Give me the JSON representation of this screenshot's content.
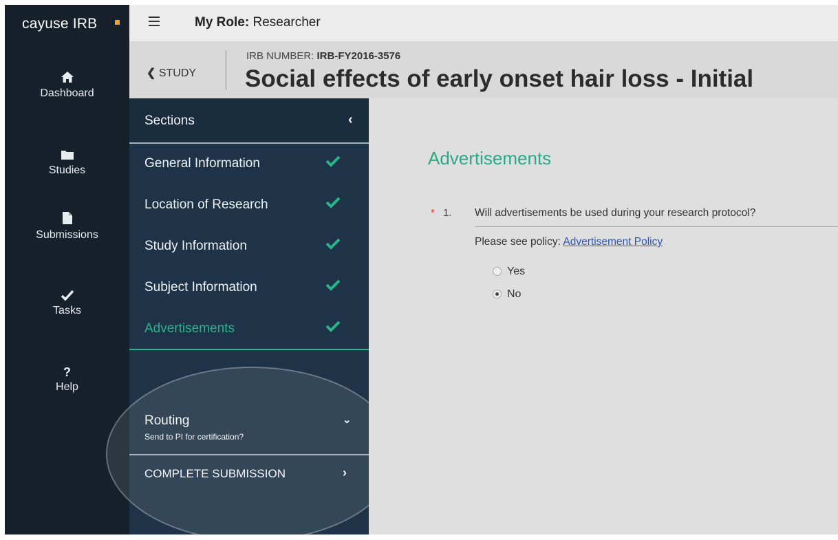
{
  "nav": {
    "brand": "cayuse IRB",
    "items": [
      {
        "label": "Dashboard",
        "icon": "home-icon"
      },
      {
        "label": "Studies",
        "icon": "folder-icon"
      },
      {
        "label": "Submissions",
        "icon": "document-icon"
      },
      {
        "label": "Tasks",
        "icon": "check-icon"
      },
      {
        "label": "Help",
        "icon": "question-icon"
      }
    ]
  },
  "topbar": {
    "role_label": "My Role:",
    "role_value": "Researcher"
  },
  "header": {
    "back_label": "STUDY",
    "irb_label": "IRB NUMBER:",
    "irb_number": "IRB-FY2016-3576",
    "title": "Social effects of early onset hair loss - Initial"
  },
  "sections": {
    "heading": "Sections",
    "items": [
      {
        "label": "General Information",
        "complete": true
      },
      {
        "label": "Location of Research",
        "complete": true
      },
      {
        "label": "Study Information",
        "complete": true
      },
      {
        "label": "Subject Information",
        "complete": true
      },
      {
        "label": "Advertisements",
        "complete": true,
        "active": true
      }
    ],
    "routing_label": "Routing",
    "routing_sub": "Send to PI for certification?",
    "complete_label": "COMPLETE SUBMISSION"
  },
  "main": {
    "title": "Advertisements",
    "question": {
      "required_mark": "*",
      "number": "1.",
      "text": "Will advertisements be used during your research protocol?",
      "policy_prefix": "Please see policy:",
      "policy_link": "Advertisement Policy",
      "options": [
        "Yes",
        "No"
      ],
      "selected": "No"
    }
  },
  "colors": {
    "nav_bg": "#16212c",
    "sections_bg": "#1e3347",
    "accent": "#2bb48c",
    "brand_dot": "#f0a12a"
  }
}
